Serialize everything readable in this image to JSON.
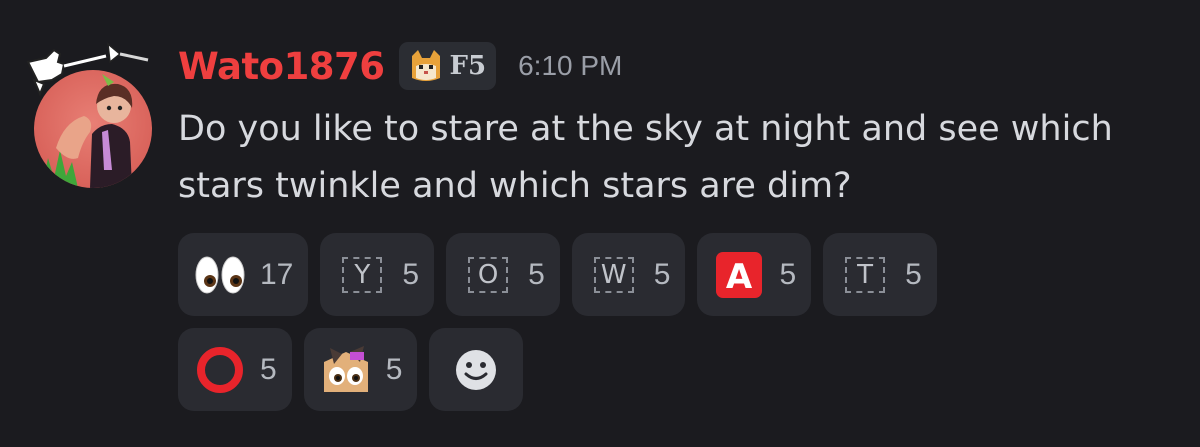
{
  "message": {
    "author": "Wato1876",
    "author_color": "#ef3f3f",
    "server_tag": {
      "icon": "cat-face-icon",
      "text": "F5"
    },
    "timestamp": "6:10 PM",
    "content": "Do you like to stare at the sky at night and see which stars twinkle and which stars are dim?",
    "avatar": {
      "icon": "user-avatar",
      "decoration": "pointing-hand-decoration"
    }
  },
  "reactions": [
    {
      "emoji": "eyes-emoji",
      "count": "17"
    },
    {
      "emoji": "regional-indicator-y",
      "letter": "Y",
      "count": "5"
    },
    {
      "emoji": "regional-indicator-o",
      "letter": "O",
      "count": "5"
    },
    {
      "emoji": "regional-indicator-w",
      "letter": "W",
      "count": "5"
    },
    {
      "emoji": "red-a-button-emoji",
      "letter": "A",
      "count": "5"
    },
    {
      "emoji": "regional-indicator-t",
      "letter": "T",
      "count": "5"
    },
    {
      "emoji": "red-circle-emoji",
      "count": "5"
    },
    {
      "emoji": "custom-eyes-face-emoji",
      "count": "5"
    }
  ],
  "add_reaction": {
    "icon": "smiley-face-icon"
  }
}
